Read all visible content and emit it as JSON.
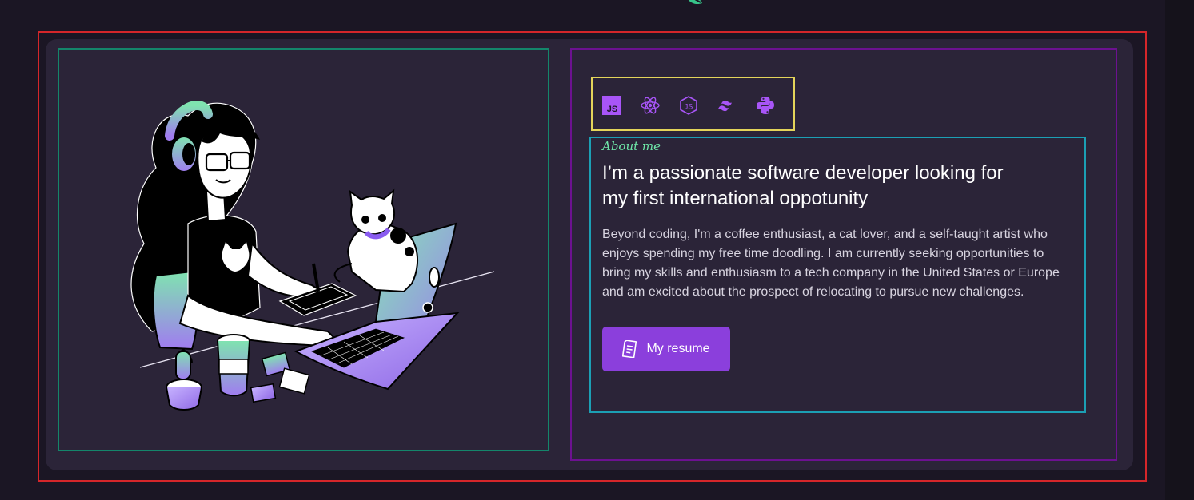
{
  "about": {
    "label": "About me",
    "headline_line1": "I’m a passionate software developer looking for",
    "headline_line2": "my first international oppotunity",
    "bio_line1": "Beyond coding, I'm a coffee enthusiast, a cat lover, and a self-taught artist who",
    "bio_line2": "enjoys spending my free time doodling. I am currently seeking opportunities to",
    "bio_line3": "bring my skills and enthusiasm to a tech company in the United States or Europe",
    "bio_line4": "and am excited about the prospect of relocating to pursue new challenges.",
    "button_label": "My resume",
    "button_icon": "document-icon"
  },
  "tech_icons": [
    "javascript-icon",
    "react-icon",
    "nodejs-icon",
    "tailwind-icon",
    "python-icon"
  ],
  "colors": {
    "background": "#1b1624",
    "card": "#2b2438",
    "accent": "#8b3fdc",
    "mint": "#6ee7a8",
    "frame_outer": "#d5262a",
    "frame_illustration": "#14866b",
    "frame_content": "#6c1190",
    "frame_tech": "#e4d45a",
    "frame_about": "#1c9fb4"
  }
}
